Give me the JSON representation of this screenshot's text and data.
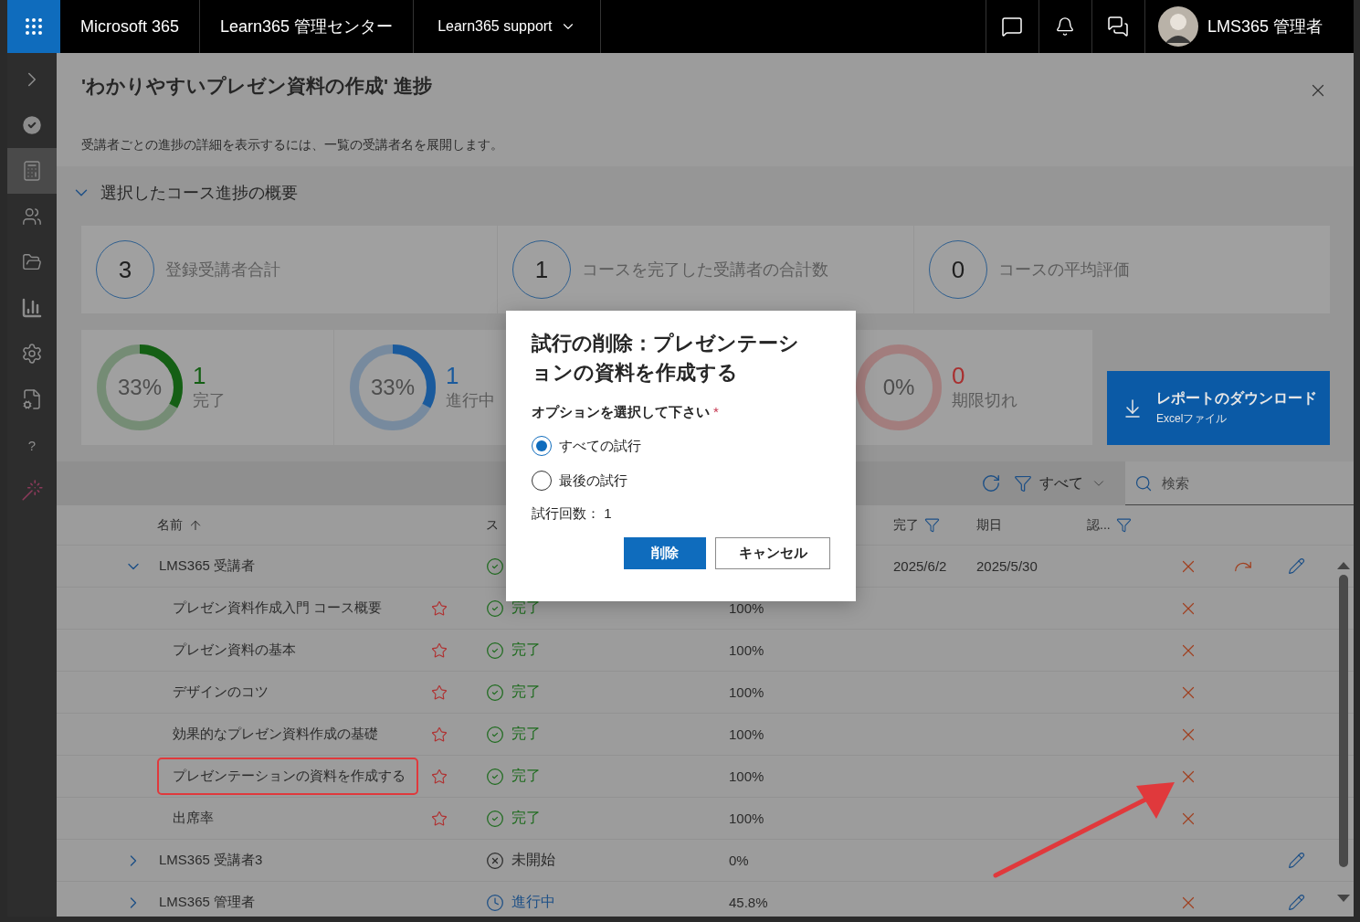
{
  "topbar": {
    "brand": "Microsoft 365",
    "app": "Learn365 管理センター",
    "tenant": "Learn365 support",
    "user": "LMS365 管理者"
  },
  "rail": [
    {
      "kind": "expand",
      "selected": false
    },
    {
      "kind": "check",
      "selected": false
    },
    {
      "kind": "report",
      "selected": true
    },
    {
      "kind": "users",
      "selected": false
    },
    {
      "kind": "folder",
      "selected": false
    },
    {
      "kind": "chart",
      "selected": false
    },
    {
      "kind": "settings",
      "selected": false
    },
    {
      "kind": "language",
      "selected": false
    },
    {
      "kind": "help",
      "label": "?",
      "selected": false
    },
    {
      "kind": "wand",
      "selected": false
    }
  ],
  "panel": {
    "title": "'わかりやすいプレゼン資料の作成' 進捗",
    "description": "受講者ごとの進捗の詳細を表示するには、一覧の受講者名を展開します。"
  },
  "summary": {
    "heading": "選択したコース進捗の概要",
    "expanded": true,
    "stats": [
      {
        "value": "3",
        "label": "登録受講者合計"
      },
      {
        "value": "1",
        "label": "コースを完了した受講者の合計数"
      },
      {
        "value": "0",
        "label": "コースの平均評価"
      }
    ],
    "donuts": [
      {
        "percent": "33%",
        "level": 0.33,
        "count": "1",
        "label": "完了",
        "color": "#145f14"
      },
      {
        "percent": "33%",
        "level": 0.33,
        "count": "1",
        "label": "進行中",
        "color": "#1a5a9c"
      },
      {
        "percent": "0%",
        "level": 0,
        "count": "0",
        "label": "期限切れ",
        "color": "#a83030"
      }
    ],
    "download": {
      "title": "レポートのダウンロード",
      "subtitle": "Excelファイル"
    }
  },
  "toolbar": {
    "filter": "すべて",
    "search_placeholder": "検索"
  },
  "table": {
    "columns": [
      {
        "label": "名前",
        "sorted": true,
        "filter": false
      },
      {
        "label": "ス",
        "sorted": false,
        "filter": false
      },
      {
        "label": "完了",
        "sorted": false,
        "filter": true
      },
      {
        "label": "期日",
        "sorted": false,
        "filter": false
      },
      {
        "label": "認...",
        "sorted": false,
        "filter": true
      }
    ],
    "rows": [
      {
        "name": "LMS365 受講者",
        "expanded": true,
        "status": {
          "kind": "complete"
        },
        "done": "2025/6/2",
        "due": "2025/5/30",
        "actions": [
          {
            "kind": "delete"
          },
          {
            "kind": "reset"
          },
          {
            "kind": "edit"
          }
        ],
        "children": [
          {
            "name": "プレゼン資料作成入門 コース概要",
            "status": {
              "kind": "complete",
              "text": "完了"
            },
            "progress": "100%",
            "highlighted": false,
            "actions": [
              {
                "kind": "delete"
              }
            ]
          },
          {
            "name": "プレゼン資料の基本",
            "status": {
              "kind": "complete",
              "text": "完了"
            },
            "progress": "100%",
            "highlighted": false,
            "actions": [
              {
                "kind": "delete"
              }
            ]
          },
          {
            "name": "デザインのコツ",
            "status": {
              "kind": "complete",
              "text": "完了"
            },
            "progress": "100%",
            "highlighted": false,
            "actions": [
              {
                "kind": "delete"
              }
            ]
          },
          {
            "name": "効果的なプレゼン資料作成の基礎",
            "status": {
              "kind": "complete",
              "text": "完了"
            },
            "progress": "100%",
            "highlighted": false,
            "actions": [
              {
                "kind": "delete"
              }
            ]
          },
          {
            "name": "プレゼンテーションの資料を作成する",
            "status": {
              "kind": "complete",
              "text": "完了"
            },
            "progress": "100%",
            "highlighted": true,
            "actions": [
              {
                "kind": "delete"
              }
            ]
          },
          {
            "name": "出席率",
            "status": {
              "kind": "complete",
              "text": "完了"
            },
            "progress": "100%",
            "highlighted": false,
            "actions": [
              {
                "kind": "delete"
              }
            ]
          }
        ]
      },
      {
        "name": "LMS365 受講者3",
        "expanded": false,
        "status": {
          "kind": "not_started",
          "text": "未開始"
        },
        "progress": "0%",
        "actions": [
          {
            "kind": "edit"
          }
        ]
      },
      {
        "name": "LMS365 管理者",
        "expanded": false,
        "status": {
          "kind": "in_progress",
          "text": "進行中"
        },
        "progress": "45.8%",
        "actions": [
          {
            "kind": "delete"
          },
          {
            "kind": "edit"
          }
        ]
      }
    ]
  },
  "dialog": {
    "title": "試行の削除：プレゼンテーションの資料を作成する",
    "prompt": "オプションを選択して下さい",
    "required_mark": "*",
    "options": [
      {
        "label": "すべての試行",
        "selected": true
      },
      {
        "label": "最後の試行",
        "selected": false
      }
    ],
    "attempts": "試行回数： 1",
    "buttons": [
      {
        "label": "削除",
        "kind": "primary"
      },
      {
        "label": "キャンセル",
        "kind": "secondary"
      }
    ]
  }
}
